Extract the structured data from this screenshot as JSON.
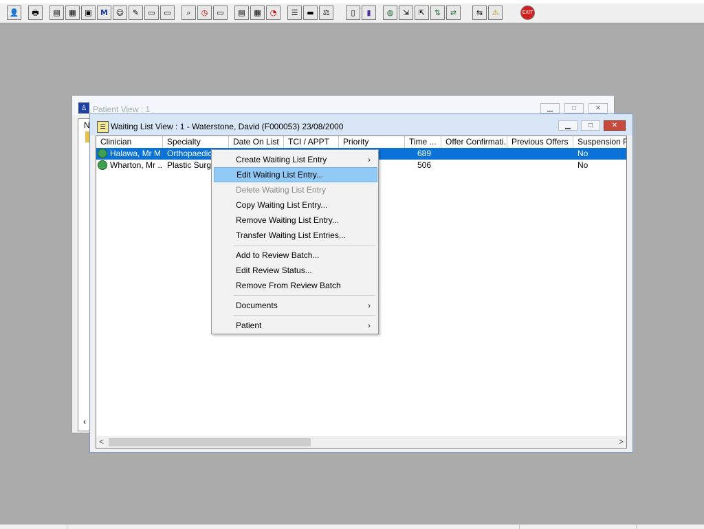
{
  "toolbar": {
    "icons": [
      "clinician-icon",
      "printer-icon",
      "book-icon",
      "form-icon",
      "document-icon",
      "m-icon",
      "person-icon",
      "notes-icon",
      "ambulance-icon",
      "vehicle-icon",
      "search-document-icon",
      "clock-icon",
      "monitor-icon",
      "chart-icon",
      "calendar-icon",
      "stopwatch-icon",
      "notepad-icon",
      "bed-icon",
      "scale-icon",
      "blank-page-icon",
      "bar-chart-icon",
      "globe-icon",
      "export-icon",
      "import-icon",
      "transfer-icon",
      "swap-icon",
      "warning-icon",
      "exit-icon"
    ],
    "exit_label": "EXIT"
  },
  "patient_window": {
    "title": "Patient View : 1",
    "panel_letter": "N",
    "scroll_left": "‹"
  },
  "waiting_window": {
    "title": "Waiting List View :  1 - Waterstone, David (F000053) 23/08/2000",
    "columns": [
      "Clinician",
      "Specialty",
      "Date On List",
      "TCI / APPT",
      "Priority",
      "Time ...",
      "Offer Confirmati...",
      "Previous Offers",
      "Suspension Pe"
    ],
    "rows": [
      {
        "clinician": "Halawa, Mr M",
        "specialty": "Orthopaedic",
        "time": "689",
        "suspension": "No",
        "selected": true
      },
      {
        "clinician": "Wharton, Mr ...",
        "specialty": "Plastic Surger",
        "time": "506",
        "suspension": "No",
        "selected": false
      }
    ]
  },
  "context_menu": {
    "items": [
      {
        "label": "Create Waiting List Entry",
        "submenu": true
      },
      {
        "label": "Edit Waiting List Entry...",
        "highlighted": true
      },
      {
        "label": "Delete Waiting List Entry",
        "disabled": true
      },
      {
        "label": "Copy Waiting List Entry..."
      },
      {
        "label": "Remove Waiting List Entry..."
      },
      {
        "label": "Transfer Waiting List Entries..."
      },
      {
        "label": "Add to Review Batch..."
      },
      {
        "label": "Edit Review Status..."
      },
      {
        "label": "Remove From Review Batch"
      },
      {
        "label": "Documents",
        "submenu": true
      },
      {
        "label": "Patient",
        "submenu": true
      }
    ]
  },
  "colors": {
    "desktop": "#ababab",
    "selection": "#0b72d8",
    "menu_highlight": "#91c9f7"
  }
}
